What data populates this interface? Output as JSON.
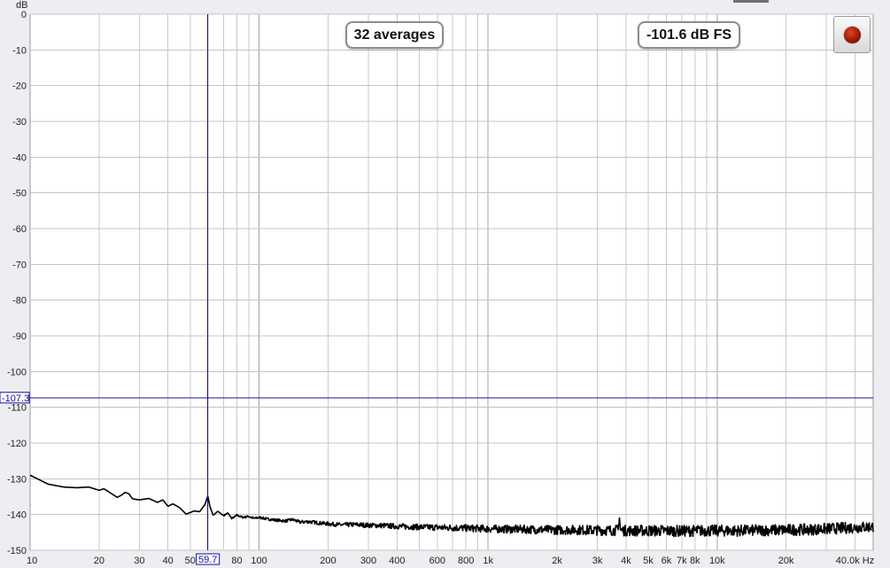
{
  "chart_data": {
    "type": "line",
    "title": "",
    "xlabel": "Hz",
    "ylabel": "dB",
    "x_scale": "log",
    "xlim": [
      10,
      48000
    ],
    "ylim": [
      -150,
      0
    ],
    "grid": true,
    "y_ticks": [
      0,
      -10,
      -20,
      -30,
      -40,
      -50,
      -60,
      -70,
      -80,
      -90,
      -100,
      -110,
      -120,
      -130,
      -140,
      -150
    ],
    "x_tick_values": [
      10,
      20,
      30,
      40,
      50,
      80,
      100,
      200,
      300,
      400,
      600,
      800,
      1000,
      2000,
      3000,
      4000,
      5000,
      6000,
      7000,
      8000,
      10000,
      20000,
      40000
    ],
    "x_tick_labels": [
      "10",
      "20",
      "30",
      "40",
      "50",
      "80",
      "100",
      "200",
      "300",
      "400",
      "600",
      "800",
      "1k",
      "2k",
      "3k",
      "4k",
      "5k",
      "6k",
      "7k",
      "8k",
      "10k",
      "20k",
      "40.0k Hz"
    ],
    "series": [
      {
        "color": "#000000",
        "x": [
          10,
          12,
          14,
          16,
          18,
          20,
          21,
          22,
          24,
          25,
          26,
          27,
          28,
          30,
          33,
          36,
          38,
          40,
          42,
          45,
          48,
          52,
          55,
          58,
          59.7,
          61,
          63,
          66,
          70,
          73,
          76,
          80,
          85,
          90,
          95,
          100,
          110,
          120,
          130,
          140,
          150,
          165,
          180,
          200,
          230,
          260,
          300,
          350,
          400,
          500,
          600,
          700,
          800,
          1000,
          1300,
          1600,
          2000,
          2500,
          3000,
          3500,
          3700,
          3740,
          3780,
          3900,
          4500,
          5500,
          7000,
          9000,
          12000,
          16000,
          20000,
          25000,
          30000,
          35000,
          40000,
          48000
        ],
        "y": [
          -129,
          -131.5,
          -132.3,
          -132.5,
          -132.3,
          -133.2,
          -132.8,
          -133.6,
          -135.2,
          -134.6,
          -133.8,
          -134.2,
          -135.6,
          -135.9,
          -135.5,
          -136.6,
          -135.9,
          -137.7,
          -137.0,
          -138.1,
          -139.9,
          -139.0,
          -139.2,
          -137.2,
          -134.8,
          -137.8,
          -140.2,
          -139.1,
          -140.3,
          -139.6,
          -141.1,
          -140.2,
          -140.8,
          -140.5,
          -141.1,
          -140.8,
          -141.3,
          -141.6,
          -141.8,
          -141.4,
          -142.1,
          -142.0,
          -142.3,
          -142.6,
          -142.9,
          -142.8,
          -143.0,
          -143.1,
          -143.3,
          -143.5,
          -143.6,
          -143.7,
          -143.8,
          -144.0,
          -144.1,
          -144.2,
          -144.3,
          -144.3,
          -144.4,
          -144.4,
          -144.4,
          -140.0,
          -144.4,
          -144.5,
          -144.5,
          -144.5,
          -144.6,
          -144.5,
          -144.5,
          -144.4,
          -144.3,
          -144.2,
          -144.0,
          -143.8,
          -143.6,
          -143.4
        ]
      }
    ],
    "cursor": {
      "x_label": "59.7",
      "y_label": "-107.3",
      "x_value": 59.7,
      "y_value": -107.3,
      "color": "#1010a8"
    }
  },
  "overlay": {
    "averages_label": "32 averages",
    "level_label": "-101.6 dB FS"
  },
  "controls": {
    "record_button_icon": "record-icon"
  }
}
